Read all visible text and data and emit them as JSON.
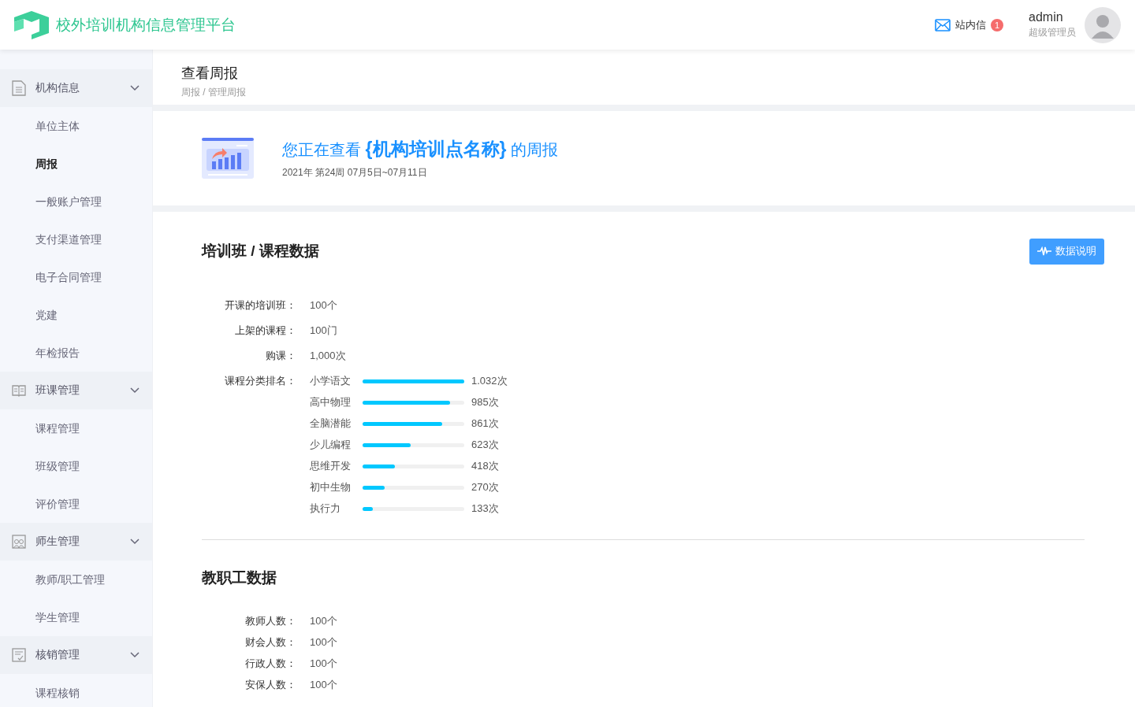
{
  "header": {
    "title": "校外培训机构信息管理平台",
    "messages": {
      "label": "站内信",
      "count": "1"
    },
    "user": {
      "name": "admin",
      "role": "超级管理员"
    }
  },
  "sidebar": {
    "groups": [
      {
        "label": "机构信息",
        "expanded": true,
        "children": [
          {
            "label": "单位主体",
            "selected": false
          },
          {
            "label": "周报",
            "selected": true
          },
          {
            "label": "一般账户管理",
            "selected": false
          },
          {
            "label": "支付渠道管理",
            "selected": false
          },
          {
            "label": "电子合同管理",
            "selected": false
          },
          {
            "label": "党建",
            "selected": false
          },
          {
            "label": "年检报告",
            "selected": false
          }
        ]
      },
      {
        "label": "班课管理",
        "expanded": true,
        "children": [
          {
            "label": "课程管理",
            "selected": false
          },
          {
            "label": "班级管理",
            "selected": false
          },
          {
            "label": "评价管理",
            "selected": false
          }
        ]
      },
      {
        "label": "师生管理",
        "expanded": true,
        "children": [
          {
            "label": "教师/职工管理",
            "selected": false
          },
          {
            "label": "学生管理",
            "selected": false
          }
        ]
      },
      {
        "label": "核销管理",
        "expanded": true,
        "children": [
          {
            "label": "课程核销",
            "selected": false
          }
        ]
      }
    ]
  },
  "page_header": {
    "title": "查看周报",
    "breadcrumb": "周报 / 管理周报"
  },
  "banner": {
    "heading": "您正在查看 **{机构培训点名称}** 的周报",
    "period": "2021年 第24周 07月5日~07月11日"
  },
  "course_section": {
    "title": "培训班 / 课程数据",
    "button": "数据说明",
    "stats": [
      {
        "label": "开课的培训班：",
        "value": "100个"
      },
      {
        "label": "上架的课程：",
        "value": "100门"
      },
      {
        "label": "购课：",
        "value": "1,000次"
      }
    ],
    "ranking": {
      "label": "课程分类排名：",
      "items": [
        {
          "name": "小学语文",
          "level": 1.0,
          "count": "1.032次"
        },
        {
          "name": "高中物理",
          "level": 0.86,
          "count": "985次"
        },
        {
          "name": "全脑潜能",
          "level": 0.78,
          "count": "861次"
        },
        {
          "name": "少儿编程",
          "level": 0.47,
          "count": "623次"
        },
        {
          "name": "思维开发",
          "level": 0.32,
          "count": "418次"
        },
        {
          "name": "初中生物",
          "level": 0.22,
          "count": "270次"
        },
        {
          "name": "执行力",
          "level": 0.1,
          "count": "133次"
        }
      ]
    }
  },
  "staff_section": {
    "title": "教职工数据",
    "stats": [
      {
        "label": "教师人数：",
        "value": "100个"
      },
      {
        "label": "财会人数：",
        "value": "100个"
      },
      {
        "label": "行政人数：",
        "value": "100个"
      },
      {
        "label": "安保人数：",
        "value": "100个"
      }
    ]
  }
}
